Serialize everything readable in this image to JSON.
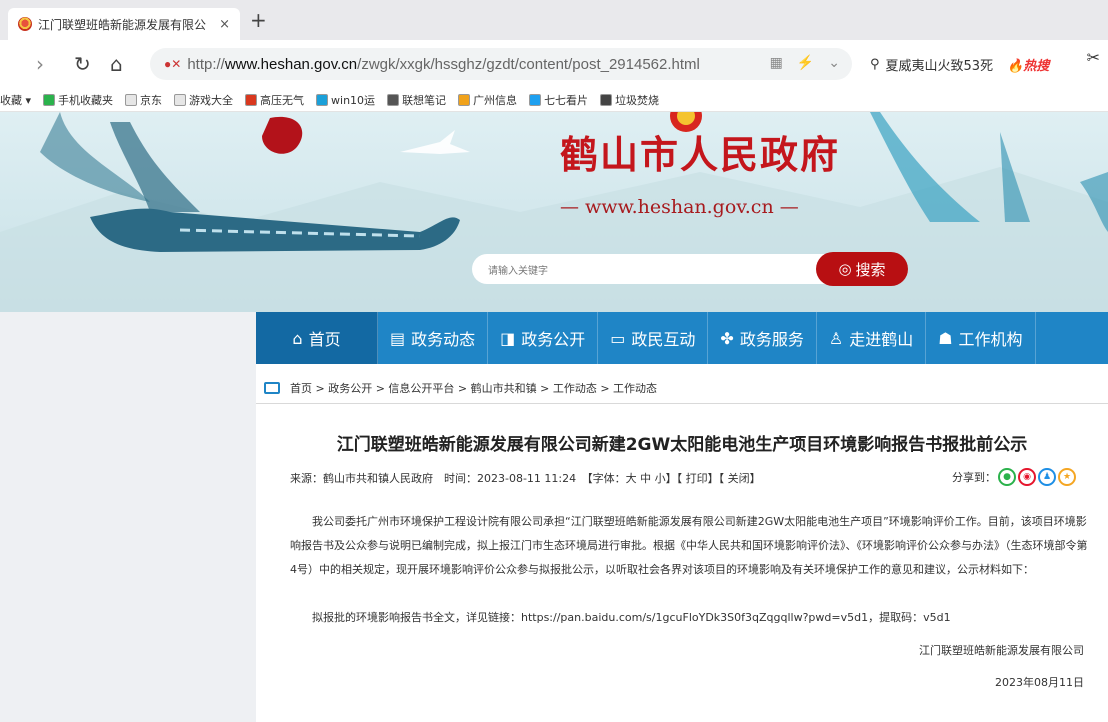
{
  "browser": {
    "tab_title": "江门联塑班皓新能源发展有限公",
    "tab_close": "×",
    "new_tab": "+",
    "url_prefix": "http://",
    "url_domain": "www.heshan.gov.cn",
    "url_path": "/zwgk/xxgk/hssghz/gzdt/content/post_2914562.html",
    "search_text": "夏威夷山火致53死",
    "search_hot": "热搜",
    "bookmarks": [
      {
        "label": "收藏 ▾",
        "color": "#ffffff"
      },
      {
        "label": "手机收藏夹",
        "color": "#2bb24c"
      },
      {
        "label": "京东",
        "color": "#e6e6e6"
      },
      {
        "label": "游戏大全",
        "color": "#e6e6e6"
      },
      {
        "label": "高压无气",
        "color": "#d9381e"
      },
      {
        "label": "win10运",
        "color": "#1ba0d9"
      },
      {
        "label": "联想笔记",
        "color": "#555555"
      },
      {
        "label": "广州信息",
        "color": "#f0a21b"
      },
      {
        "label": "七七看片",
        "color": "#1ea0f0"
      },
      {
        "label": "垃圾焚烧",
        "color": "#444444"
      }
    ]
  },
  "site": {
    "title": "鹤山市人民政府",
    "url_text": "— www.heshan.gov.cn —",
    "search_placeholder": "请输入关键字",
    "search_button": "搜索",
    "nav": [
      {
        "label": "首页",
        "icon": "⌂"
      },
      {
        "label": "政务动态",
        "icon": "▤"
      },
      {
        "label": "政务公开",
        "icon": "◨"
      },
      {
        "label": "政民互动",
        "icon": "▭"
      },
      {
        "label": "政务服务",
        "icon": "✤"
      },
      {
        "label": "走进鹤山",
        "icon": "♙"
      },
      {
        "label": "工作机构",
        "icon": "☗"
      }
    ],
    "breadcrumb": "首页 > 政务公开 > 信息公开平台 > 鹤山市共和镇 > 工作动态 > 工作动态"
  },
  "article": {
    "title": "江门联塑班皓新能源发展有限公司新建2GW太阳能电池生产项目环境影响报告书报批前公示",
    "meta": "来源：鹤山市共和镇人民政府　时间：2023-08-11 11:24　【字体：大 中 小】【 打印】【 关闭】",
    "share_label": "分享到：",
    "paragraph": "我公司委托广州市环境保护工程设计院有限公司承担“江门联塑班皓新能源发展有限公司新建2GW太阳能电池生产项目”环境影响评价工作。目前，该项目环境影响报告书及公众参与说明已编制完成，拟上报江门市生态环境局进行审批。根据《中华人民共和国环境影响评价法》、《环境影响评价公众参与办法》（生态环境部令第4号）中的相关规定，现开展环境影响评价公众参与拟报批公示，以听取社会各界对该项目的环境影响及有关环境保护工作的意见和建议，公示材料如下：",
    "link_text": "拟报批的环境影响报告书全文，详见链接：https://pan.baidu.com/s/1gcuFloYDk3S0f3qZqgqllw?pwd=v5d1，提取码：v5d1",
    "signature": "江门联塑班皓新能源发展有限公司",
    "date": "2023年08月11日"
  },
  "colors": {
    "nav_blue": "#1f85c6",
    "title_red": "#c4161c",
    "search_red": "#b80f12"
  }
}
